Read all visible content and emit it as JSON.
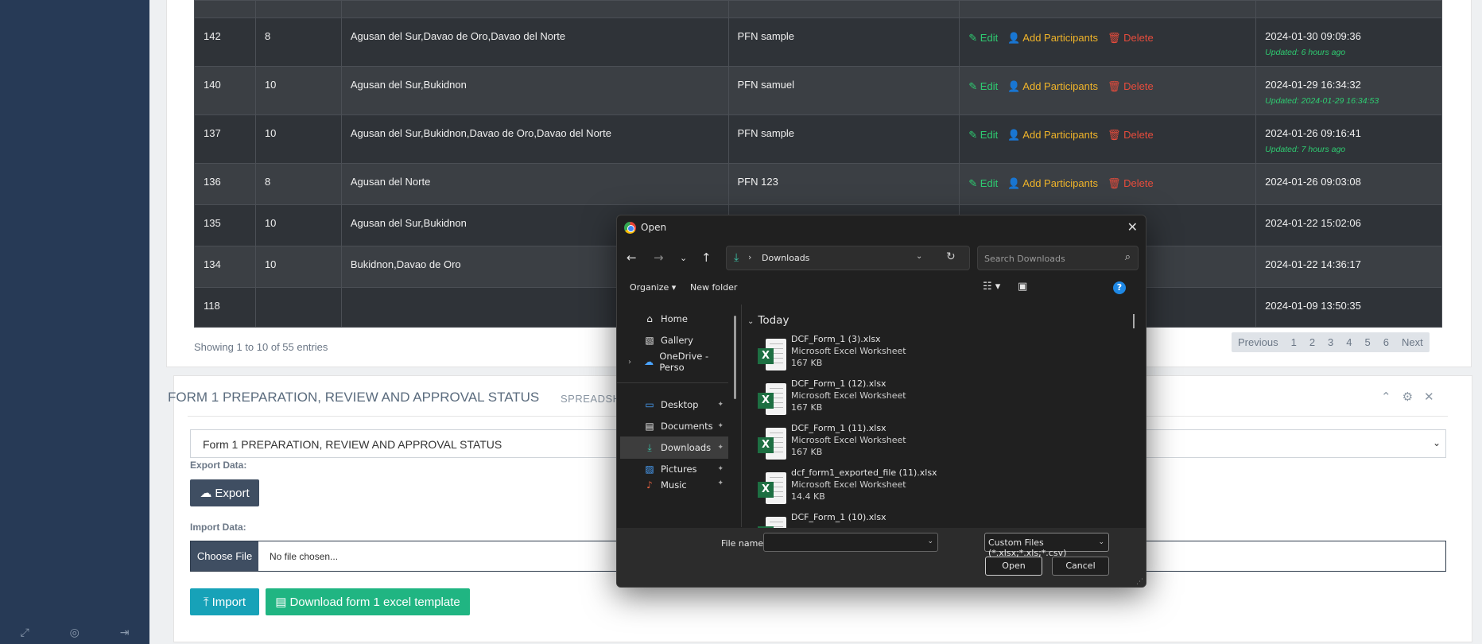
{
  "sidebar": {
    "footer_icons": [
      "expand-icon",
      "eye-slash-icon",
      "sign-out-icon"
    ]
  },
  "table": {
    "rows": [
      {
        "id": "",
        "col2": "",
        "areas": "",
        "name": "",
        "date": "",
        "updated": ""
      },
      {
        "id": "142",
        "col2": "8",
        "areas": "Agusan del Sur,Davao de Oro,Davao del Norte",
        "name": "PFN sample",
        "date": "2024-01-30 09:09:36",
        "updated": "Updated: 6 hours ago"
      },
      {
        "id": "140",
        "col2": "10",
        "areas": "Agusan del Sur,Bukidnon",
        "name": "PFN samuel",
        "date": "2024-01-29 16:34:32",
        "updated": "Updated: 2024-01-29 16:34:53"
      },
      {
        "id": "137",
        "col2": "10",
        "areas": "Agusan del Sur,Bukidnon,Davao de Oro,Davao del Norte",
        "name": "PFN sample",
        "date": "2024-01-26 09:16:41",
        "updated": "Updated: 7 hours ago"
      },
      {
        "id": "136",
        "col2": "8",
        "areas": "Agusan del Norte",
        "name": "PFN 123",
        "date": "2024-01-26 09:03:08",
        "updated": ""
      },
      {
        "id": "135",
        "col2": "10",
        "areas": "Agusan del Sur,Bukidnon",
        "name": "",
        "date": "2024-01-22 15:02:06",
        "updated": ""
      },
      {
        "id": "134",
        "col2": "10",
        "areas": "Bukidnon,Davao de Oro",
        "name": "",
        "date": "2024-01-22 14:36:17",
        "updated": ""
      },
      {
        "id": "118",
        "col2": "",
        "areas": "",
        "name": "",
        "date": "2024-01-09 13:50:35",
        "updated": ""
      }
    ],
    "actions": {
      "edit": "Edit",
      "add": "Add Participants",
      "delete": "Delete",
      "delete_partial": "ete"
    },
    "showing": "Showing 1 to 10 of 55 entries",
    "pager": {
      "previous": "Previous",
      "pages": [
        "1",
        "2",
        "3",
        "4",
        "5",
        "6"
      ],
      "next": "Next"
    }
  },
  "form_panel": {
    "title": "FORM 1 PREPARATION, REVIEW AND APPROVAL STATUS",
    "subtitle": "SPREADSH",
    "select_value": "Form 1 PREPARATION, REVIEW AND APPROVAL STATUS",
    "export_label": "Export Data:",
    "export_button": "Export",
    "import_label": "Import Data:",
    "choose_file": "Choose File",
    "no_file": "No file chosen...",
    "import_button": "Import",
    "download_button": "Download form 1 excel template"
  },
  "dialog": {
    "title": "Open",
    "path": "Downloads",
    "search_placeholder": "Search Downloads",
    "organize": "Organize",
    "new_folder": "New folder",
    "nav": [
      {
        "label": "Home",
        "icon": "home-icon"
      },
      {
        "label": "Gallery",
        "icon": "gallery-icon"
      },
      {
        "label": "OneDrive - Perso",
        "icon": "cloud-icon"
      },
      {
        "label": "Desktop",
        "icon": "desktop-icon"
      },
      {
        "label": "Documents",
        "icon": "documents-icon"
      },
      {
        "label": "Downloads",
        "icon": "download-icon"
      },
      {
        "label": "Pictures",
        "icon": "pictures-icon"
      },
      {
        "label": "Music",
        "icon": "music-icon"
      }
    ],
    "group": "Today",
    "files": [
      {
        "name": "DCF_Form_1 (3).xlsx",
        "type": "Microsoft Excel Worksheet",
        "size": "167 KB"
      },
      {
        "name": "DCF_Form_1 (12).xlsx",
        "type": "Microsoft Excel Worksheet",
        "size": "167 KB"
      },
      {
        "name": "DCF_Form_1 (11).xlsx",
        "type": "Microsoft Excel Worksheet",
        "size": "167 KB"
      },
      {
        "name": "dcf_form1_exported_file (11).xlsx",
        "type": "Microsoft Excel Worksheet",
        "size": "14.4 KB"
      },
      {
        "name": "DCF_Form_1 (10).xlsx",
        "type": "",
        "size": ""
      }
    ],
    "filename_label": "File name:",
    "filename_value": "",
    "filetype": "Custom Files (*.xlsx;*.xls;*.csv)",
    "open_button": "Open",
    "cancel_button": "Cancel"
  }
}
